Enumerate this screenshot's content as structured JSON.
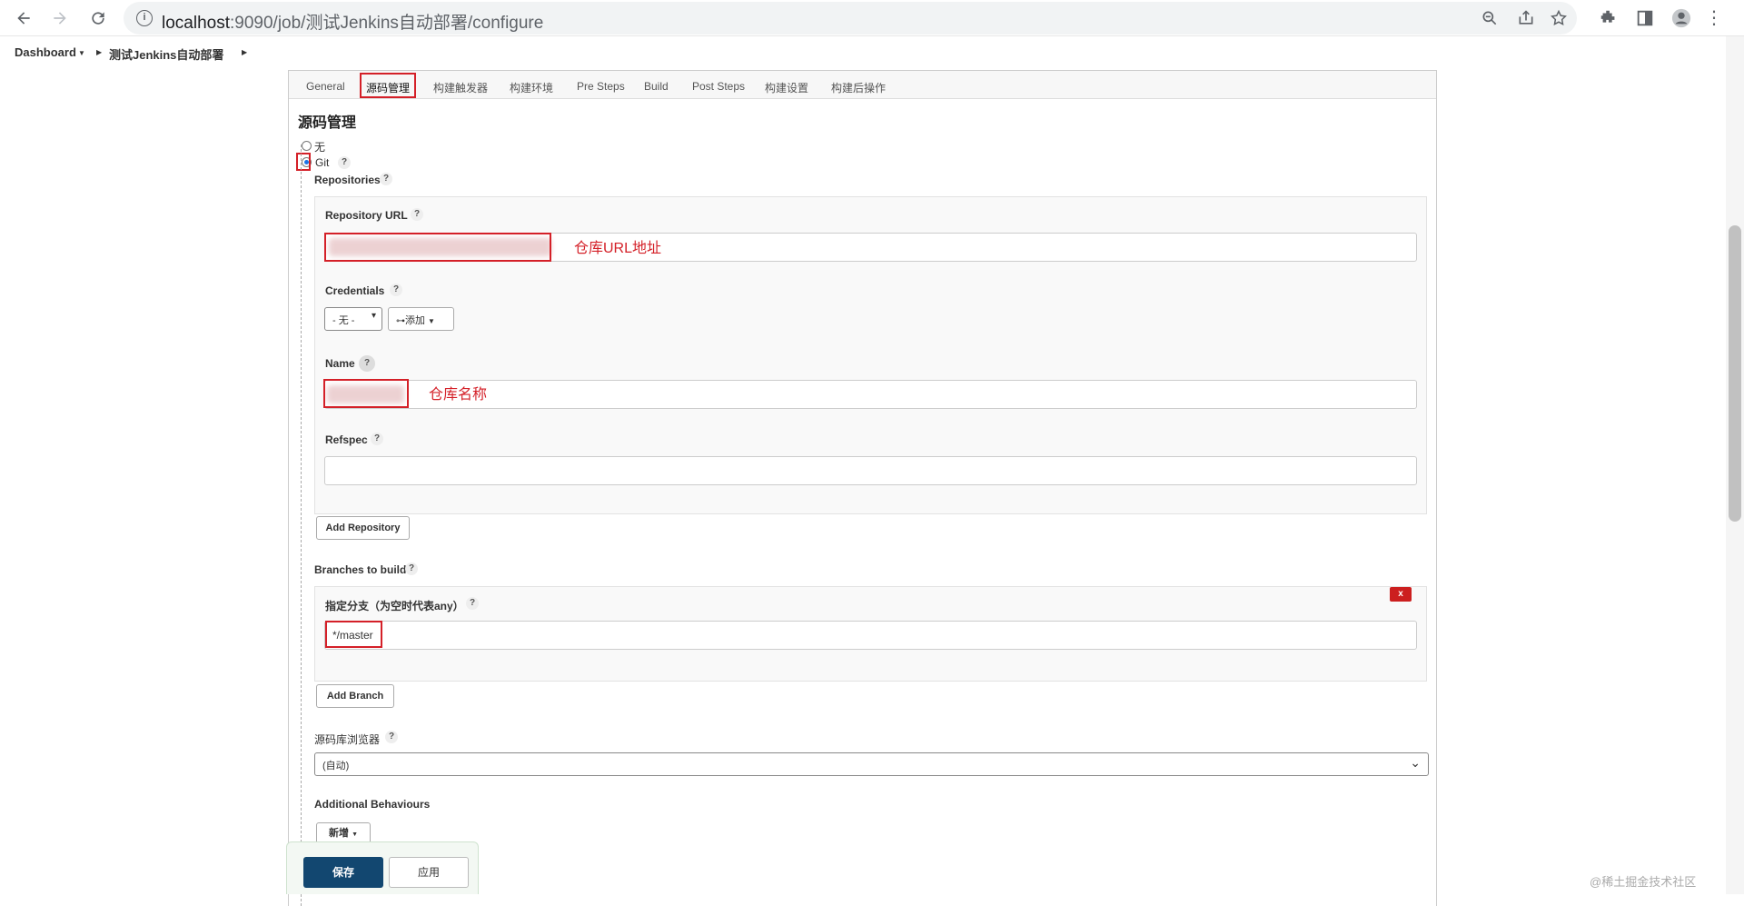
{
  "browser": {
    "url_host": "localhost",
    "url_rest": ":9090/job/测试Jenkins自动部署/configure"
  },
  "breadcrumb": {
    "dashboard": "Dashboard",
    "job": "测试Jenkins自动部署"
  },
  "tabs": [
    "General",
    "源码管理",
    "构建触发器",
    "构建环境",
    "Pre Steps",
    "Build",
    "Post Steps",
    "构建设置",
    "构建后操作"
  ],
  "scm": {
    "title": "源码管理",
    "option_none": "无",
    "option_git": "Git",
    "help": "?",
    "repositories_label": "Repositories",
    "repo_url_label": "Repository URL",
    "repo_url_annotation": "仓库URL地址",
    "credentials_label": "Credentials",
    "credentials_value": "- 无 -",
    "add_credentials": "添加",
    "name_label": "Name",
    "name_annotation": "仓库名称",
    "refspec_label": "Refspec",
    "add_repository": "Add Repository",
    "branches_label": "Branches to build",
    "branch_spec_label": "指定分支（为空时代表any）",
    "branch_spec_value": "*/master",
    "remove_branch": "x",
    "add_branch": "Add Branch",
    "browser_label": "源码库浏览器",
    "browser_value": "(自动)",
    "additional_label": "Additional Behaviours",
    "add_behaviour": "新增"
  },
  "savebar": {
    "save": "保存",
    "apply": "应用"
  },
  "watermark": "@稀土掘金技术社区",
  "colors": {
    "annotation": "#d42028",
    "save_button": "#124770",
    "remove_button": "#cc1f1f"
  }
}
